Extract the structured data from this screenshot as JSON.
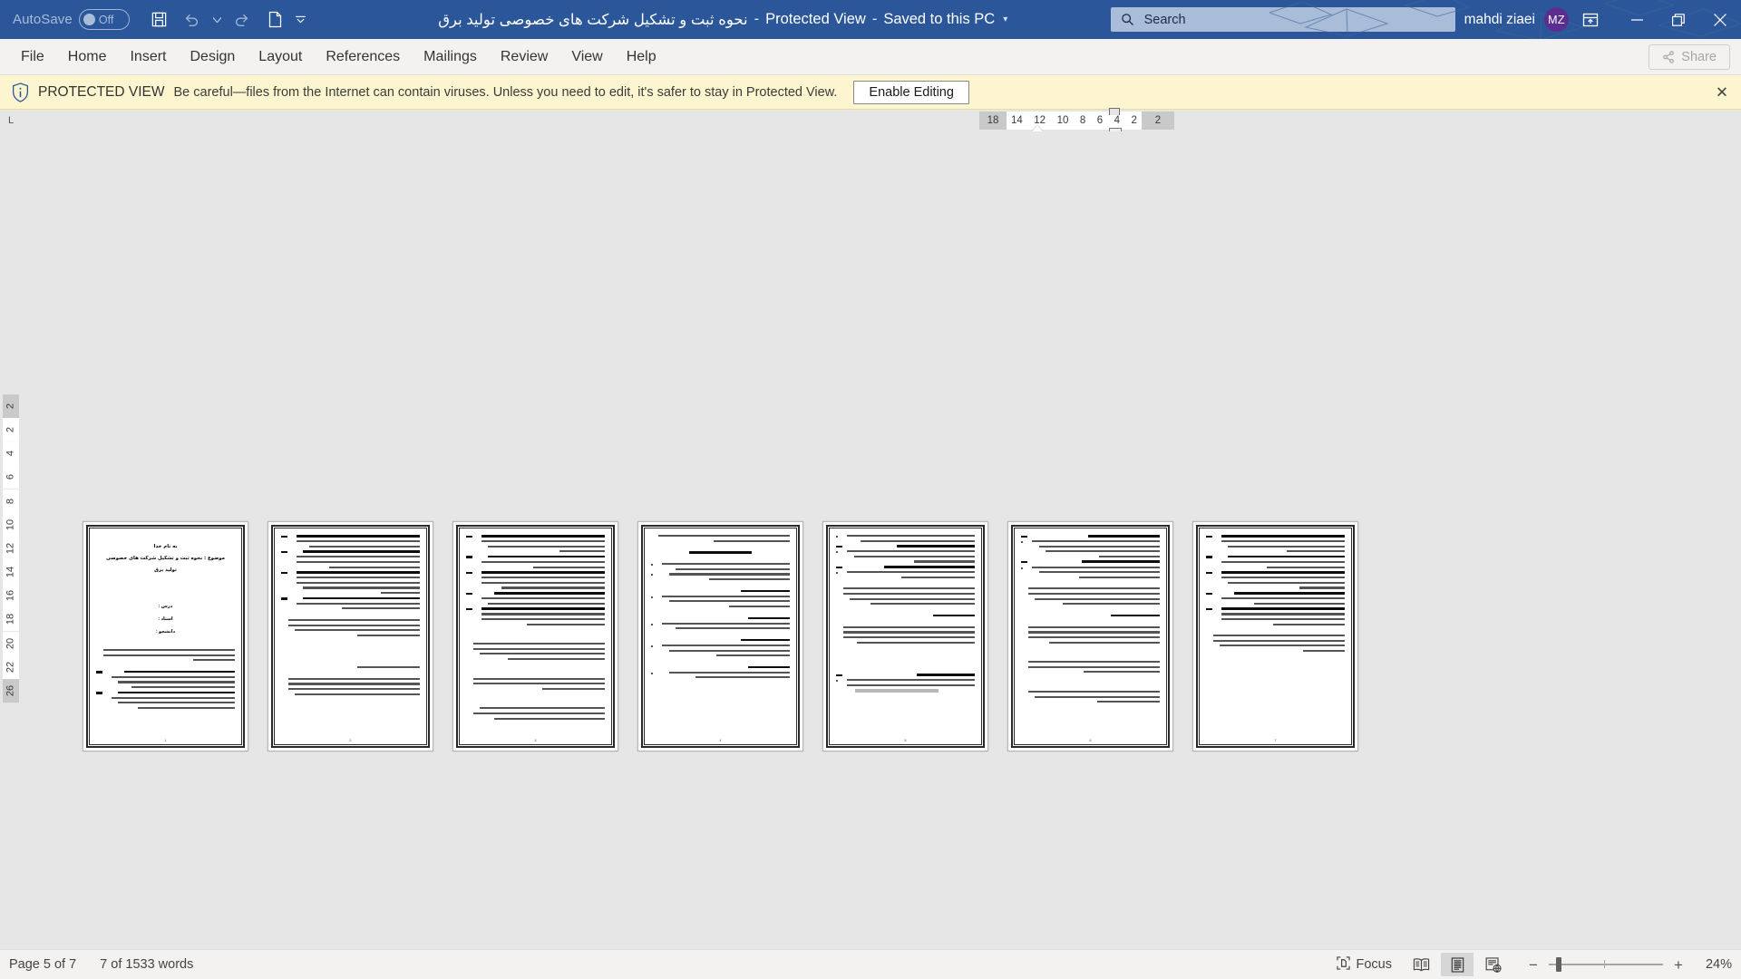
{
  "titlebar": {
    "autosave_label": "AutoSave",
    "autosave_state": "Off",
    "quick_access": [
      {
        "name": "save-icon",
        "tooltip": "Save"
      },
      {
        "name": "undo-icon",
        "tooltip": "Undo"
      },
      {
        "name": "undo-dropdown-icon",
        "tooltip": "Undo options"
      },
      {
        "name": "redo-icon",
        "tooltip": "Redo"
      },
      {
        "name": "new-document-icon",
        "tooltip": "New"
      },
      {
        "name": "customize-quick-access-toolbar-icon",
        "tooltip": "Customize Quick Access Toolbar"
      }
    ],
    "document_name": "نحوه ثبت و تشکیل شرکت های خصوصی تولید برق",
    "separator": "-",
    "protected_view_label": "Protected View",
    "saved_state": "Saved to this PC",
    "saved_caret": "▾",
    "search_placeholder": "Search",
    "search_value": "",
    "user_name": "mahdi ziaei",
    "user_initials": "MZ",
    "avatar_color": "#5c2d91",
    "accent_color": "#2b579a",
    "window_buttons": {
      "ribbon_display": "Ribbon Display Options",
      "minimize": "Minimize",
      "restore": "Restore Down",
      "close": "Close"
    }
  },
  "ribbon": {
    "tabs": [
      {
        "label": "File"
      },
      {
        "label": "Home"
      },
      {
        "label": "Insert"
      },
      {
        "label": "Design"
      },
      {
        "label": "Layout"
      },
      {
        "label": "References"
      },
      {
        "label": "Mailings"
      },
      {
        "label": "Review"
      },
      {
        "label": "View"
      },
      {
        "label": "Help"
      }
    ],
    "share_label": "Share"
  },
  "protected_view": {
    "icon": "shield-info-icon",
    "title": "PROTECTED VIEW",
    "message": "Be careful—files from the Internet can contain viruses. Unless you need to edit, it's safer to stay in Protected View.",
    "enable_button": "Enable Editing",
    "close_label": "✕",
    "background_color": "#fdf5cf"
  },
  "rulers": {
    "tab_selector": "L",
    "horizontal_numbers": [
      "18",
      "14",
      "12",
      "10",
      "8",
      "6",
      "4",
      "2"
    ],
    "horizontal_right_number": "2",
    "vertical_top_number": "2",
    "vertical_numbers": [
      "2",
      "4",
      "6",
      "8",
      "10",
      "12",
      "14",
      "16",
      "18",
      "20",
      "22"
    ],
    "vertical_bottom_number": "26"
  },
  "document": {
    "page_count": 7,
    "pages": [
      {
        "number": "1",
        "type": "title",
        "title_lines": [
          "به نام خدا",
          "موضوع : نحوه ثبت و تشکیل شرکت های خصوصی",
          "تولید برق"
        ],
        "fields": [
          "درس :",
          "استاد :",
          "دانشجو :"
        ]
      },
      {
        "number": "2",
        "type": "body"
      },
      {
        "number": "3",
        "type": "body"
      },
      {
        "number": "4",
        "type": "body"
      },
      {
        "number": "5",
        "type": "body"
      },
      {
        "number": "6",
        "type": "body",
        "has_highlight": true
      },
      {
        "number": "7",
        "type": "body"
      }
    ]
  },
  "statusbar": {
    "page_indicator": "Page 5 of 7",
    "word_count": "7 of 1533 words",
    "focus_label": "Focus",
    "view_modes": [
      {
        "name": "read-mode-icon",
        "label": "Read Mode",
        "active": false
      },
      {
        "name": "print-layout-icon",
        "label": "Print Layout",
        "active": true
      },
      {
        "name": "web-layout-icon",
        "label": "Web Layout",
        "active": false
      }
    ],
    "zoom_out": "−",
    "zoom_in": "+",
    "zoom_level": "24%"
  }
}
